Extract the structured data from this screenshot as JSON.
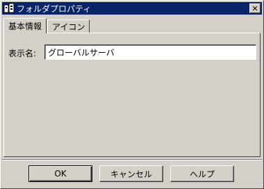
{
  "window": {
    "title": "フォルダプロパティ",
    "close_glyph": "✕"
  },
  "tabs": [
    {
      "label": "基本情報",
      "active": true
    },
    {
      "label": "アイコン",
      "active": false
    }
  ],
  "form": {
    "display_name_label": "表示名:",
    "display_name_value": "グローバルサーバ"
  },
  "buttons": {
    "ok": "OK",
    "cancel": "キャンセル",
    "help": "ヘルプ"
  },
  "colors": {
    "titlebar": "#0a246a",
    "face": "#d4d0c8"
  }
}
